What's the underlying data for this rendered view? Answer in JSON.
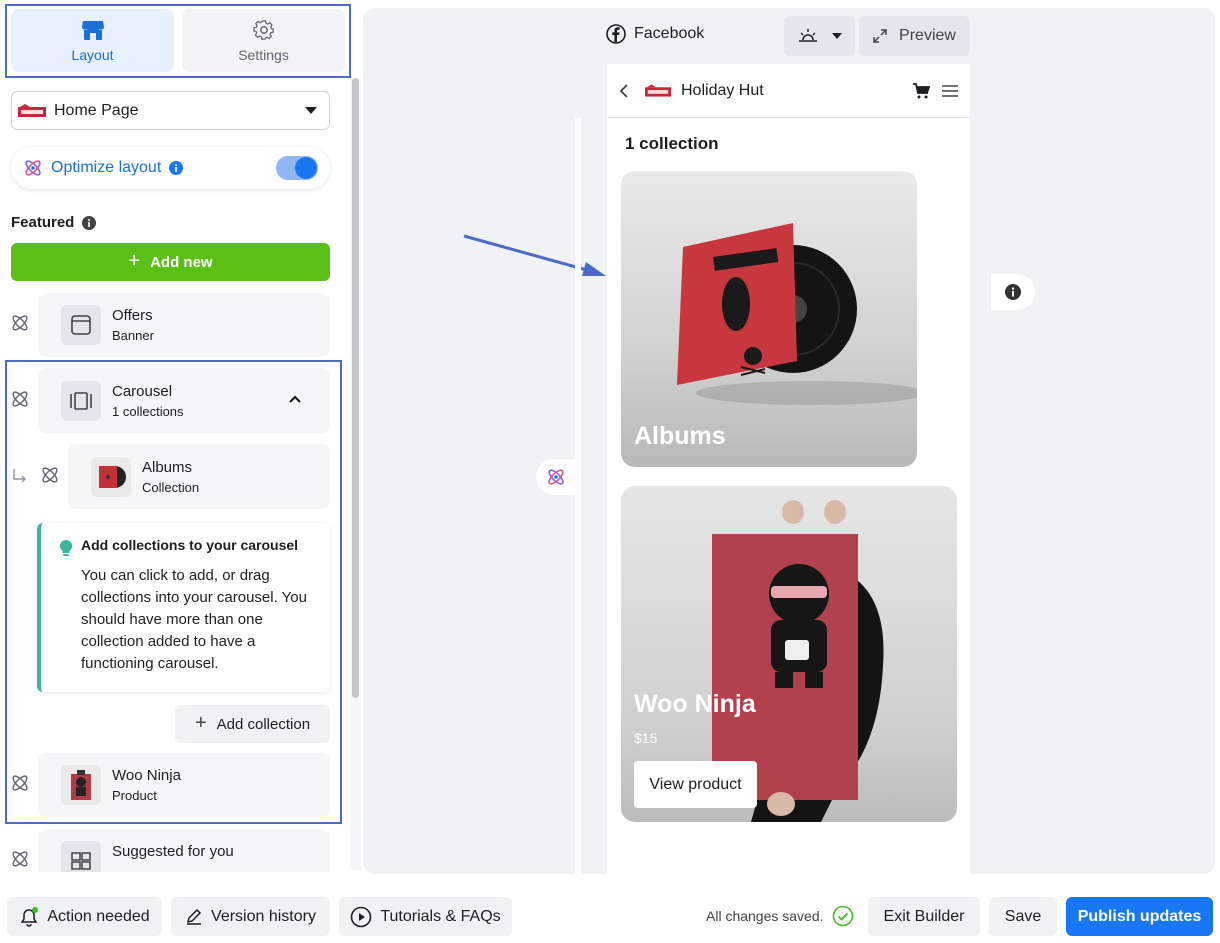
{
  "sidebar": {
    "tabs": [
      {
        "label": "Layout",
        "icon": "store-icon",
        "active": true
      },
      {
        "label": "Settings",
        "icon": "gear-icon",
        "active": false
      }
    ],
    "page_select": {
      "value": "Home Page"
    },
    "optimize": {
      "label": "Optimize layout",
      "enabled": true
    },
    "featured_label": "Featured",
    "add_new_label": "Add new",
    "items": [
      {
        "title": "Offers",
        "subtitle": "Banner"
      },
      {
        "title": "Carousel",
        "subtitle": "1 collections"
      },
      {
        "title": "Albums",
        "subtitle": "Collection"
      },
      {
        "title": "Woo Ninja",
        "subtitle": "Product"
      },
      {
        "title": "Suggested for you",
        "subtitle": ""
      }
    ],
    "tip": {
      "title": "Add collections to your carousel",
      "body": "You can click to add, or drag collections into your carousel. You should have more than one collection added to have a functioning carousel."
    },
    "add_collection_label": "Add collection"
  },
  "preview": {
    "platform_label": "Facebook",
    "preview_label": "Preview",
    "shop_name": "Holiday Hut",
    "heading": "1 collection",
    "album_card": {
      "name": "Albums"
    },
    "product_card": {
      "name": "Woo Ninja",
      "price": "$15",
      "button": "View product"
    }
  },
  "bottombar": {
    "action_needed": "Action needed",
    "version_history": "Version history",
    "tutorials": "Tutorials & FAQs",
    "saved_status": "All changes saved.",
    "exit": "Exit Builder",
    "save": "Save",
    "publish": "Publish updates"
  },
  "colors": {
    "accent_blue": "#1877f2",
    "add_green": "#5ac016",
    "highlight_outline": "#4a6bc8",
    "tip_border": "#3ab69c"
  }
}
